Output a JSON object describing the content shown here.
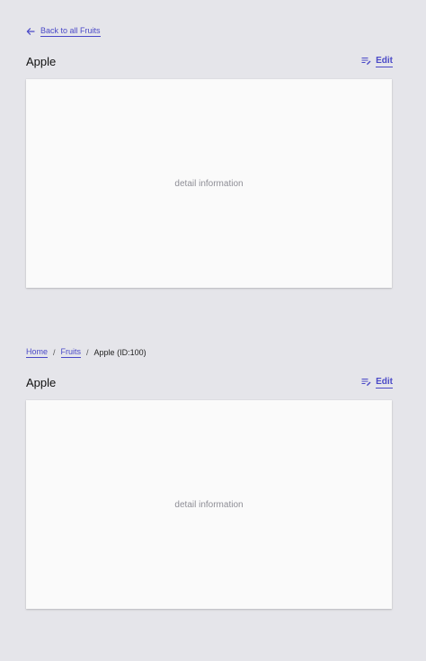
{
  "section_one": {
    "back_link_label": "Back to all Fruits",
    "title": "Apple",
    "edit_label": "Edit",
    "card_text": "detail information"
  },
  "section_two": {
    "breadcrumb": {
      "home": "Home",
      "separator": "/",
      "fruits": "Fruits",
      "current": "Apple (ID:100)"
    },
    "title": "Apple",
    "edit_label": "Edit",
    "card_text": "detail information"
  },
  "colors": {
    "background": "#e5e5ea",
    "card": "#fafafa",
    "link": "#4a49c7"
  },
  "icons": {
    "back": "arrow-left-icon",
    "edit": "edit-list-icon"
  }
}
